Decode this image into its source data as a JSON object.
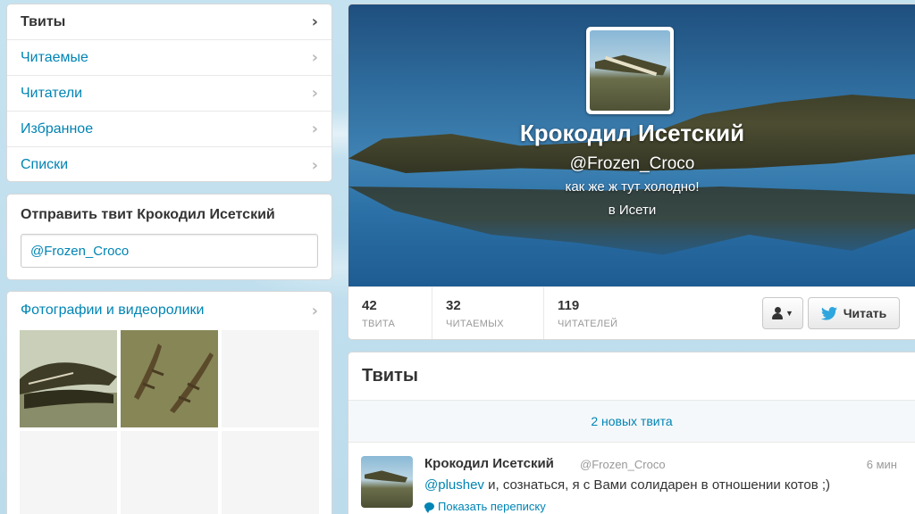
{
  "nav": {
    "items": [
      {
        "label": "Твиты",
        "active": true
      },
      {
        "label": "Читаемые",
        "active": false
      },
      {
        "label": "Читатели",
        "active": false
      },
      {
        "label": "Избранное",
        "active": false
      },
      {
        "label": "Списки",
        "active": false
      }
    ]
  },
  "compose": {
    "title": "Отправить твит Крокодил Исетский",
    "value": "@Frozen_Croco"
  },
  "media": {
    "title": "Фотографии и видеоролики"
  },
  "profile": {
    "name": "Крокодил Исетский",
    "handle": "@Frozen_Croco",
    "bio": "как же ж тут холодно!",
    "location": "в Исети",
    "stats": [
      {
        "num": "42",
        "label": "ТВИТА"
      },
      {
        "num": "32",
        "label": "ЧИТАЕМЫХ"
      },
      {
        "num": "119",
        "label": "ЧИТАТЕЛЕЙ"
      }
    ],
    "follow_label": "Читать"
  },
  "tweets": {
    "title": "Твиты",
    "new_notice": "2 новых твита",
    "items": [
      {
        "name": "Крокодил Исетский",
        "handle": "@Frozen_Croco",
        "time": "6 мин",
        "mention": "@plushev",
        "text": " и, сознаться, я с Вами солидарен в отношении котов ;)",
        "conversation": "Показать переписку"
      }
    ]
  },
  "colors": {
    "link": "#0084b4",
    "page_bg": "#c0deed"
  }
}
